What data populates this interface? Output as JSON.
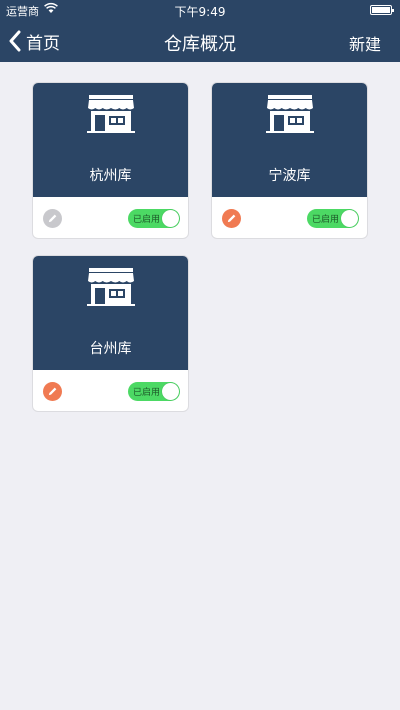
{
  "status_bar": {
    "carrier": "运营商",
    "time": "下午9:49"
  },
  "nav": {
    "back_label": "首页",
    "title": "仓库概况",
    "new_label": "新建"
  },
  "colors": {
    "header": "#2b4565",
    "toggle_on": "#4cd964",
    "edit_active": "#f07a52",
    "edit_disabled": "#c8c8cc"
  },
  "warehouses": [
    {
      "name": "杭州库",
      "status": "已启用",
      "edit_icon": "pencil-icon",
      "edit_state": "disabled"
    },
    {
      "name": "宁波库",
      "status": "已启用",
      "edit_icon": "pencil-icon",
      "edit_state": "active"
    },
    {
      "name": "台州库",
      "status": "已启用",
      "edit_icon": "pencil-icon",
      "edit_state": "active"
    }
  ]
}
